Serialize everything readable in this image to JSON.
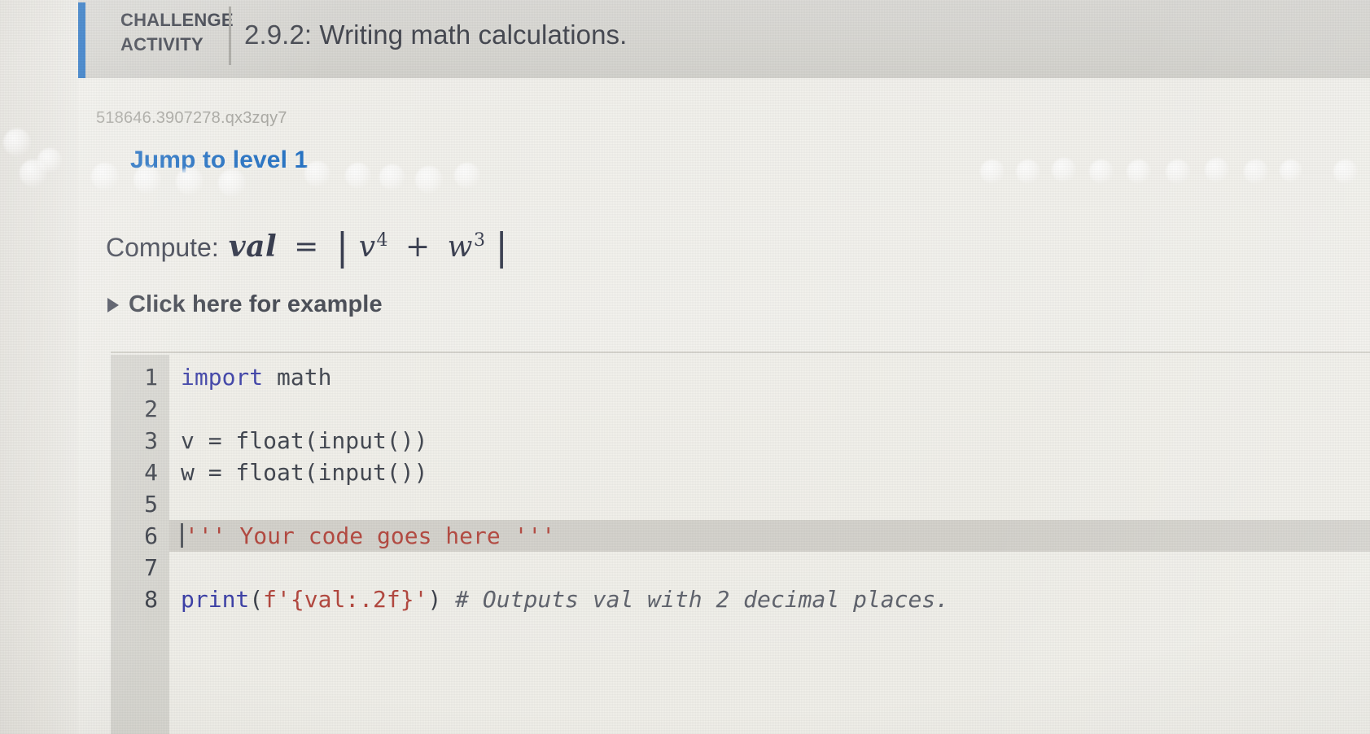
{
  "header": {
    "badge_label": "CHALLENGE\nACTIVITY",
    "badge_line1": "CHALLENGE",
    "badge_line2": "ACTIVITY",
    "title": "2.9.2: Writing math calculations.",
    "accent_color": "#1f6fc4",
    "band_color": "#d7d6d1"
  },
  "activity": {
    "id": "518646.3907278.qx3zqy7",
    "jump_to_level": "Jump to level 1",
    "jump_color": "#1f6fc4"
  },
  "prompt": {
    "label": "Compute:",
    "formula_plain": "val = |v^4 + w^3|",
    "lhs": "val",
    "equals": "=",
    "bar_open": "|",
    "bar_close": "|",
    "term1_base": "v",
    "term1_exp": "4",
    "operator": "+",
    "term2_base": "w",
    "term2_exp": "3"
  },
  "disclosure": {
    "label": "Click here for example",
    "icon": "triangle-right-icon",
    "expanded": false
  },
  "editor": {
    "language": "python",
    "cursor_line": 6,
    "highlight_line": 6,
    "lines": [
      {
        "number": "1",
        "text": "import math",
        "tokens": [
          {
            "t": "import",
            "c": "tok-kw"
          },
          {
            "t": " math",
            "c": "tok-plain"
          }
        ]
      },
      {
        "number": "2",
        "text": "",
        "tokens": []
      },
      {
        "number": "3",
        "text": "v = float(input())",
        "tokens": [
          {
            "t": "v = float(input())",
            "c": "tok-plain"
          }
        ]
      },
      {
        "number": "4",
        "text": "w = float(input())",
        "tokens": [
          {
            "t": "w = float(input())",
            "c": "tok-plain"
          }
        ]
      },
      {
        "number": "5",
        "text": "",
        "tokens": []
      },
      {
        "number": "6",
        "text": "''' Your code goes here '''",
        "tokens": [
          {
            "t": "''' Your code goes here '''",
            "c": "tok-str"
          }
        ]
      },
      {
        "number": "7",
        "text": "",
        "tokens": []
      },
      {
        "number": "8",
        "text": "print(f'{val:.2f}') # Outputs val with 2 decimal places.",
        "tokens": [
          {
            "t": "print",
            "c": "tok-fn"
          },
          {
            "t": "(",
            "c": "tok-plain"
          },
          {
            "t": "f'{val:.2f}'",
            "c": "tok-str"
          },
          {
            "t": ")",
            "c": "tok-plain"
          },
          {
            "t": " # Outputs val with 2 decimal places.",
            "c": "tok-comment"
          }
        ]
      }
    ]
  },
  "colors": {
    "keyword": "#3b3fa8",
    "string": "#b3453c",
    "comment": "#5d616b",
    "text": "#3a3f49",
    "gutter": "#d9d8d2",
    "editor_bg": "#f1f0ea",
    "page_bg": "#f2f1ec"
  }
}
